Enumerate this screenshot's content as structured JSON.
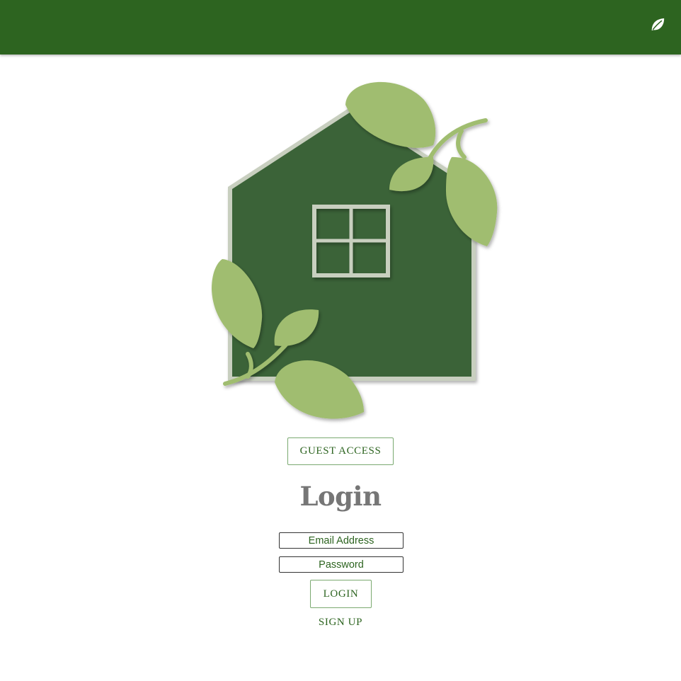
{
  "header": {
    "icon": "leaf-icon",
    "background_color": "#2d6420"
  },
  "hero": {
    "icon": "house-with-leaves-logo",
    "house_color": "#3a6337",
    "leaf_color": "#a0bd6f",
    "frame_color": "#c8cfbf"
  },
  "actions": {
    "guest_access_label": "GUEST ACCESS"
  },
  "login_form": {
    "title": "Login",
    "email_placeholder": "Email Address",
    "password_placeholder": "Password",
    "login_label": "LOGIN",
    "signup_label": "SIGN UP"
  },
  "colors": {
    "accent": "#2d6420",
    "title_gray": "#767676",
    "button_border": "#7aa970"
  }
}
